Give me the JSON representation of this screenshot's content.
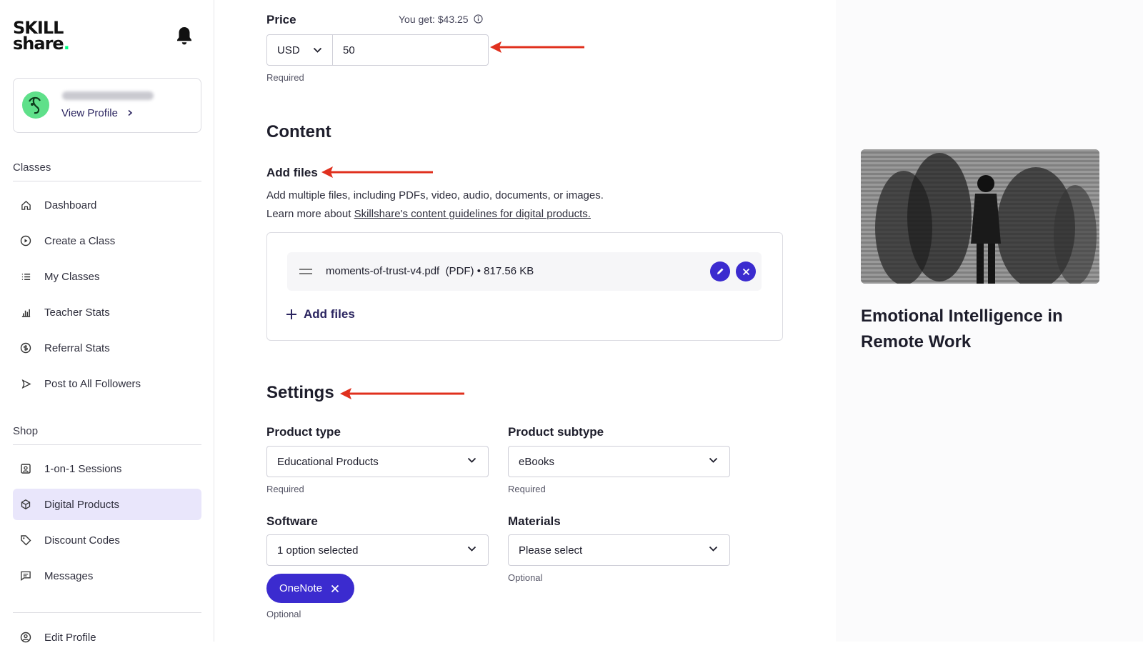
{
  "brand": {
    "logo_line1": "SKILL",
    "logo_line2": "share",
    "logo_dot": "."
  },
  "profile": {
    "view_profile": "View Profile"
  },
  "sidebar": {
    "classes_label": "Classes",
    "classes_items": [
      {
        "label": "Dashboard",
        "icon": "home-icon"
      },
      {
        "label": "Create a Class",
        "icon": "play-circle-icon"
      },
      {
        "label": "My Classes",
        "icon": "list-icon"
      },
      {
        "label": "Teacher Stats",
        "icon": "bar-chart-icon"
      },
      {
        "label": "Referral Stats",
        "icon": "dollar-circle-icon"
      },
      {
        "label": "Post to All Followers",
        "icon": "send-icon"
      }
    ],
    "shop_label": "Shop",
    "shop_items": [
      {
        "label": "1-on-1 Sessions",
        "icon": "person-board-icon"
      },
      {
        "label": "Digital Products",
        "icon": "cube-icon",
        "active": true
      },
      {
        "label": "Discount Codes",
        "icon": "tag-icon"
      },
      {
        "label": "Messages",
        "icon": "chat-icon"
      }
    ],
    "footer_items": [
      {
        "label": "Edit Profile",
        "icon": "user-circle-icon"
      }
    ]
  },
  "price": {
    "label": "Price",
    "you_get": "You get: $43.25",
    "currency": "USD",
    "value": "50",
    "required": "Required"
  },
  "content": {
    "heading": "Content",
    "add_files_label": "Add files",
    "desc1": "Add multiple files, including PDFs, video, audio, documents, or images.",
    "desc2_prefix": "Learn more about ",
    "desc2_link": "Skillshare's content guidelines for digital products.",
    "file": {
      "name": "moments-of-trust-v4.pdf",
      "type": "(PDF)",
      "size": "• 817.56 KB"
    },
    "add_files_button": "Add files"
  },
  "settings": {
    "heading": "Settings",
    "product_type": {
      "label": "Product type",
      "value": "Educational Products",
      "help": "Required"
    },
    "product_subtype": {
      "label": "Product subtype",
      "value": "eBooks",
      "help": "Required"
    },
    "software": {
      "label": "Software",
      "value": "1 option selected",
      "chip": "OneNote",
      "help": "Optional"
    },
    "materials": {
      "label": "Materials",
      "value": "Please select",
      "help": "Optional"
    }
  },
  "preview": {
    "title": "Emotional Intelligence in Remote Work"
  },
  "colors": {
    "accent": "#3b2bcf",
    "active_bg": "#e9e6fb",
    "annotation_arrow": "#e0301e",
    "brand_dot": "#00ff84"
  }
}
